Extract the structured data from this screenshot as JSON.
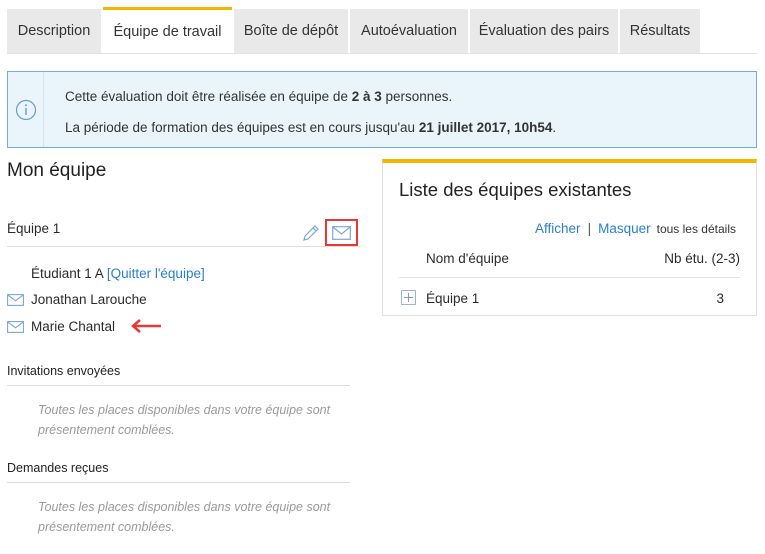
{
  "tabs": [
    {
      "label": "Description",
      "active": false
    },
    {
      "label": "Équipe de travail",
      "active": true
    },
    {
      "label": "Boîte de dépôt",
      "active": false
    },
    {
      "label": "Autoévaluation",
      "active": false
    },
    {
      "label": "Évaluation des pairs",
      "active": false
    },
    {
      "label": "Résultats",
      "active": false
    }
  ],
  "info": {
    "icon": "info-icon",
    "line1_pre": "Cette évaluation doit être réalisée en équipe de ",
    "line1_bold": "2 à 3",
    "line1_post": " personnes.",
    "line2_pre": "La période de formation des équipes est en cours jusqu'au ",
    "line2_bold": "21 juillet 2017, 10h54",
    "line2_post": "."
  },
  "my_team": {
    "heading": "Mon équipe",
    "team_name": "Équipe 1",
    "edit_icon": "pencil-icon",
    "mail_icon": "mail-icon",
    "self_name": "Étudiant 1 A",
    "leave_link": "[Quitter l'équipe]",
    "members": [
      "Jonathan Larouche",
      "Marie Chantal"
    ]
  },
  "invitations": {
    "title": "Invitations envoyées",
    "message": "Toutes les places disponibles dans votre équipe sont présentement comblées."
  },
  "requests": {
    "title": "Demandes reçues",
    "message": "Toutes les places disponibles dans votre équipe sont présentement comblées."
  },
  "teams_list": {
    "title": "Liste des équipes existantes",
    "show_label": "Afficher",
    "separator": "|",
    "hide_label": "Masquer",
    "details_label": "tous les détails",
    "col_name": "Nom d'équipe",
    "col_count": "Nb étu. (2-3)",
    "rows": [
      {
        "name": "Équipe 1",
        "count": "3"
      }
    ]
  },
  "colors": {
    "accent": "#f2b600",
    "link": "#2a7fd0",
    "info_border": "#6fb0da",
    "highlight": "#e53935"
  }
}
